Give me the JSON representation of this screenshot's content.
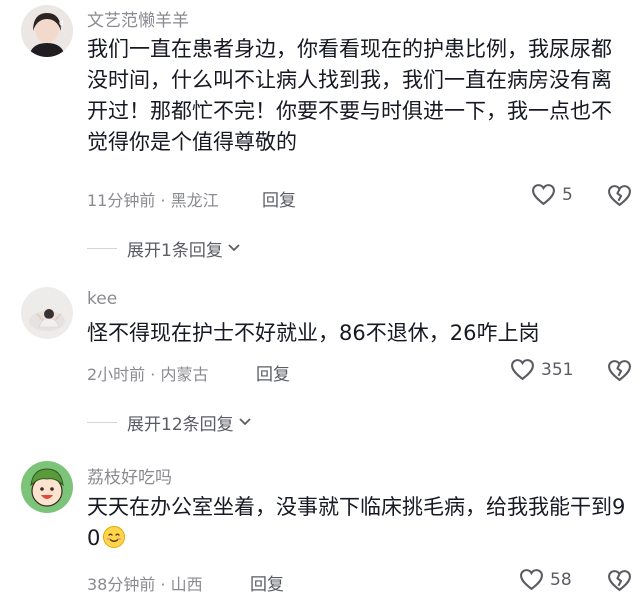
{
  "comments": [
    {
      "username": "文艺范懒羊羊",
      "text": "我们一直在患者身边，你看看现在的护患比例，我尿尿都没时间，什么叫不让病人找到我，我们一直在病房没有离开过！那都忙不完！你要不要与时俱进一下，我一点也不觉得你是个值得尊敬的",
      "time_location": "11分钟前 · 黑龙江",
      "reply_label": "回复",
      "likes": "5",
      "expand_label": "展开1条回复"
    },
    {
      "username": "kee",
      "text": "怪不得现在护士不好就业，86不退休，26咋上岗",
      "time_location": "2小时前 · 内蒙古",
      "reply_label": "回复",
      "likes": "351",
      "expand_label": "展开12条回复"
    },
    {
      "username": "荔枝好吃吗",
      "text": "天天在办公室坐着，没事就下临床挑毛病，给我我能干到90",
      "time_location": "38分钟前 · 山西",
      "reply_label": "回复",
      "likes": "58"
    }
  ],
  "icons": {
    "like": "heart-outline-icon",
    "dislike": "broken-heart-icon",
    "expand": "chevron-down-icon",
    "emoji": "smiling-face-emoji"
  },
  "colors": {
    "text": "#161823",
    "secondary": "#8a8b91",
    "action": "#5b5c63"
  }
}
